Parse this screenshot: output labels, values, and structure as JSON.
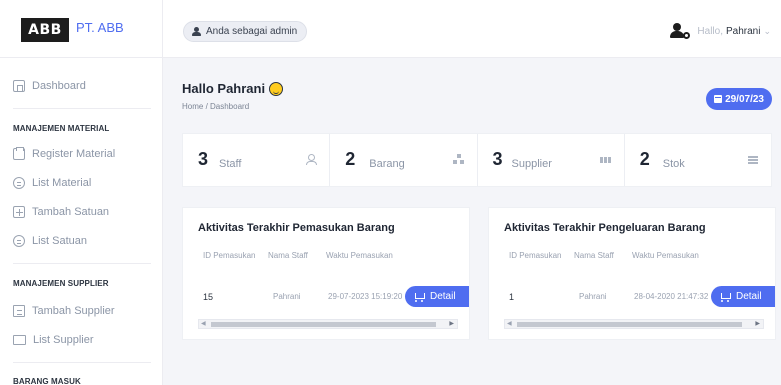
{
  "brand": {
    "logo_text": "ABB",
    "name": "PT. ABB"
  },
  "sidebar": {
    "dashboard": "Dashboard",
    "sections": [
      {
        "heading": "MANAJEMEN MATERIAL",
        "items": [
          "Register Material",
          "List Material",
          "Tambah Satuan",
          "List Satuan"
        ]
      },
      {
        "heading": "MANAJEMEN SUPPLIER",
        "items": [
          "Tambah Supplier",
          "List Supplier"
        ]
      },
      {
        "heading": "BARANG MASUK",
        "items": []
      }
    ]
  },
  "topbar": {
    "admin_pill": "Anda sebagai admin",
    "hallo_prefix": "Hallo,",
    "user_name": "Pahrani",
    "chevron": "⌄"
  },
  "header": {
    "greeting": "Hallo Pahrani",
    "breadcrumb": "Home / Dashboard",
    "date": "29/07/23"
  },
  "stats": [
    {
      "value": "3",
      "label": "Staff",
      "icon": "user-icon"
    },
    {
      "value": "2",
      "label": "Barang",
      "icon": "boxes-icon"
    },
    {
      "value": "3",
      "label": "Supplier",
      "icon": "people-icon"
    },
    {
      "value": "2",
      "label": "Stok",
      "icon": "stack-icon"
    }
  ],
  "cards": {
    "incoming": {
      "title": "Aktivitas Terakhir Pemasukan Barang",
      "columns": [
        "ID Pemasukan",
        "Nama Staff",
        "Waktu Pemasukan"
      ],
      "row": {
        "id": "15",
        "staff": "Pahrani",
        "time": "29-07-2023 15:19:20",
        "action": "Detail"
      }
    },
    "outgoing": {
      "title": "Aktivitas Terakhir Pengeluaran Barang",
      "columns": [
        "ID Pemasukan",
        "Nama Staff",
        "Waktu Pemasukan"
      ],
      "row": {
        "id": "1",
        "staff": "Pahrani",
        "time": "28-04-2020 21:47:32",
        "action": "Detail"
      }
    }
  },
  "colors": {
    "accent": "#4f6df0",
    "sidebar_bg": "#ffffff",
    "page_bg": "#f4f5f9"
  }
}
